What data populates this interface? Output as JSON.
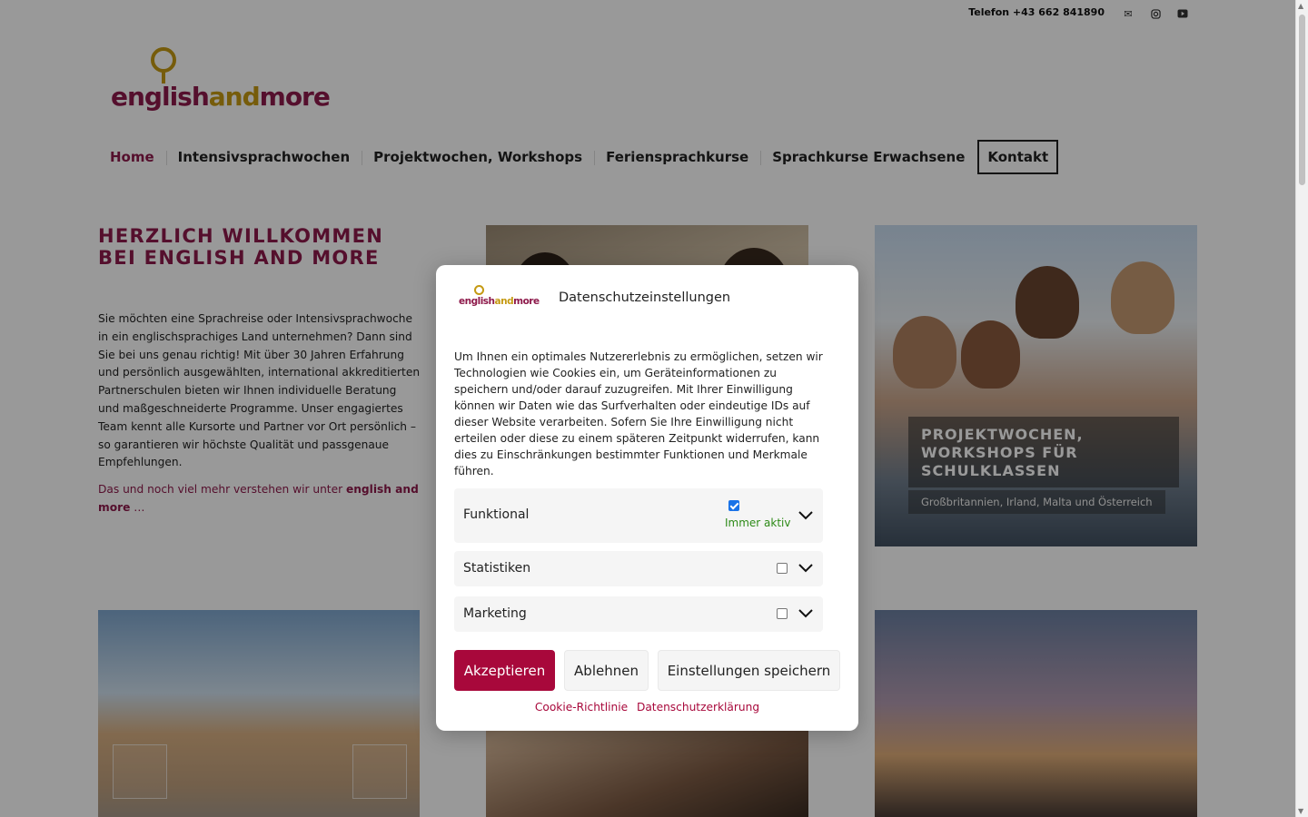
{
  "topbar": {
    "phone": "Telefon +43 662 841890",
    "social_icons": [
      "mail-icon",
      "instagram-icon",
      "youtube-icon"
    ]
  },
  "logo": {
    "part1": "english",
    "part2": "and",
    "part3": "more"
  },
  "nav": {
    "items": [
      {
        "label": "Home",
        "active": true
      },
      {
        "label": "Intensivsprachwochen"
      },
      {
        "label": "Projektwochen, Workshops"
      },
      {
        "label": "Feriensprachkurse"
      },
      {
        "label": "Sprachkurse Erwachsene"
      },
      {
        "label": "Kontakt",
        "boxed": true
      }
    ]
  },
  "welcome": {
    "title": "HERZLICH WILLKOMMEN BEI ENGLISH AND MORE",
    "text": "Sie möchten eine Sprachreise oder Intensivsprachwoche in ein englischsprachiges Land unternehmen? Dann sind Sie bei uns genau richtig! Mit über 30 Jahren Erfahrung und persönlich ausgewählten, international akkreditierten Partnerschulen bieten wir Ihnen individuelle Beratung und maßgeschneiderte Programme. Unser engagiertes Team kennt alle Kursorte und Partner vor Ort persönlich – so garantieren wir höchste Qualität und passgenaue Empfehlungen.",
    "more_prefix": "Das und noch viel mehr verstehen wir unter ",
    "more_bold": "english and more",
    "more_suffix": " …"
  },
  "tiles": {
    "projekt_title": "PROJEKTWOCHEN, WORKSHOPS FÜR SCHULKLASSEN",
    "projekt_sub": "Großbritannien, Irland, Malta und Österreich"
  },
  "consent": {
    "title": "Datenschutzeinstellungen",
    "logo": {
      "part1": "english",
      "part2": "and",
      "part3": "more"
    },
    "text": "Um Ihnen ein optimales Nutzererlebnis zu ermöglichen, setzen wir Technologien wie Cookies ein, um Geräteinformationen zu speichern und/oder darauf zuzugreifen. Mit Ihrer Einwilligung können wir Daten wie das Surfverhalten oder eindeutige IDs auf dieser Website verarbeiten. Sofern Sie Ihre Einwilligung nicht erteilen oder diese zu einem späteren Zeitpunkt widerrufen, kann dies zu Einschränkungen bestimmter Funktionen und Merkmale führen.",
    "categories": [
      {
        "label": "Funktional",
        "checked": true,
        "status": "Immer aktiv"
      },
      {
        "label": "Statistiken",
        "checked": false
      },
      {
        "label": "Marketing",
        "checked": false
      }
    ],
    "buttons": {
      "accept": "Akzeptieren",
      "deny": "Ablehnen",
      "save": "Einstellungen speichern"
    },
    "links": {
      "cookie_policy": "Cookie-Richtlinie",
      "privacy": "Datenschutzerklärung"
    },
    "colors": {
      "accent": "#a8083b",
      "active_status": "#2d8a17"
    }
  }
}
